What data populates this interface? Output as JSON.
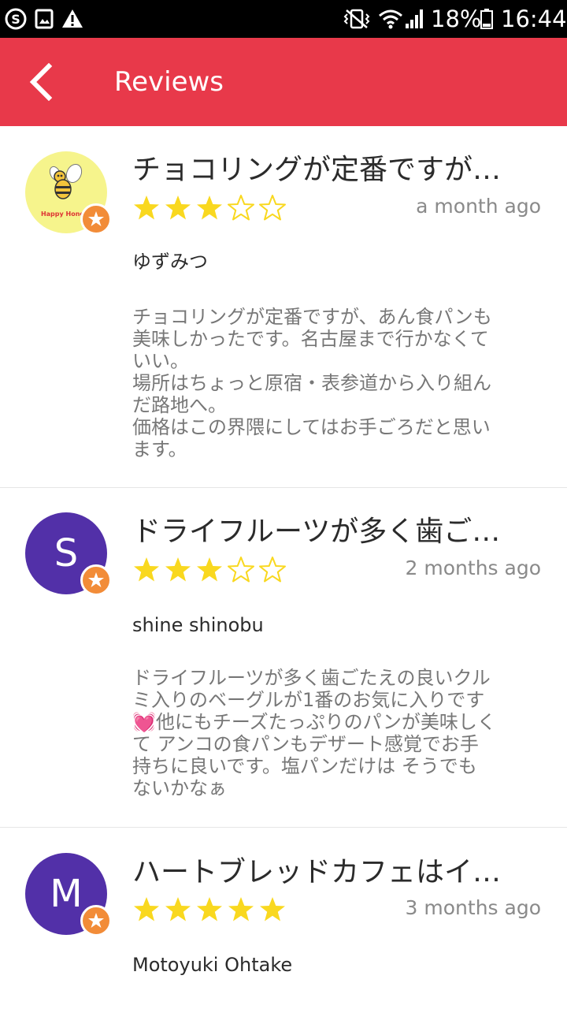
{
  "status_bar": {
    "icons_left": [
      "skype-icon",
      "image-icon",
      "warning-icon"
    ],
    "icons_right": [
      "vibrate-icon",
      "wifi-icon",
      "signal-icon",
      "battery-icon"
    ],
    "battery": "18%",
    "time": "16:44"
  },
  "app_bar": {
    "title": "Reviews",
    "back_icon": "back-arrow-icon",
    "color": "#e8394a"
  },
  "reviews": [
    {
      "title": "チョコリングが定番ですが…",
      "rating": 3,
      "max_rating": 5,
      "date": "a month ago",
      "author": "ゆずみつ",
      "avatar_text": "Happy Honey",
      "body": "チョコリングが定番ですが、あん食パンも\n美味しかったです。名古屋まで行かなくて\nいい。\n場所はちょっと原宿・表参道から入り組ん\nだ路地へ。\n価格はこの界隈にしてはお手ごろだと思い\nます。"
    },
    {
      "title": "ドライフルーツが多く歯ご…",
      "rating": 3,
      "max_rating": 5,
      "date": "2 months ago",
      "author": "shine shinobu",
      "avatar_letter": "S",
      "avatar_color": "#5230a8",
      "body": "ドライフルーツが多く歯ごたえの良いクル\nミ入りのベーグルが1番のお気に入りです\n💓他にもチーズたっぷりのパンが美味しく\nて アンコの食パンもデザート感覚でお手\n持ちに良いです。塩パンだけは そうでも\nないかなぁ"
    },
    {
      "title": "ハートブレッドカフェはイ…",
      "rating": 5,
      "max_rating": 5,
      "date": "3 months ago",
      "author": "Motoyuki Ohtake",
      "avatar_letter": "M",
      "avatar_color": "#5230a8",
      "body": ""
    }
  ],
  "colors": {
    "star_fill": "#f9d81f",
    "badge": "#f28c38"
  }
}
